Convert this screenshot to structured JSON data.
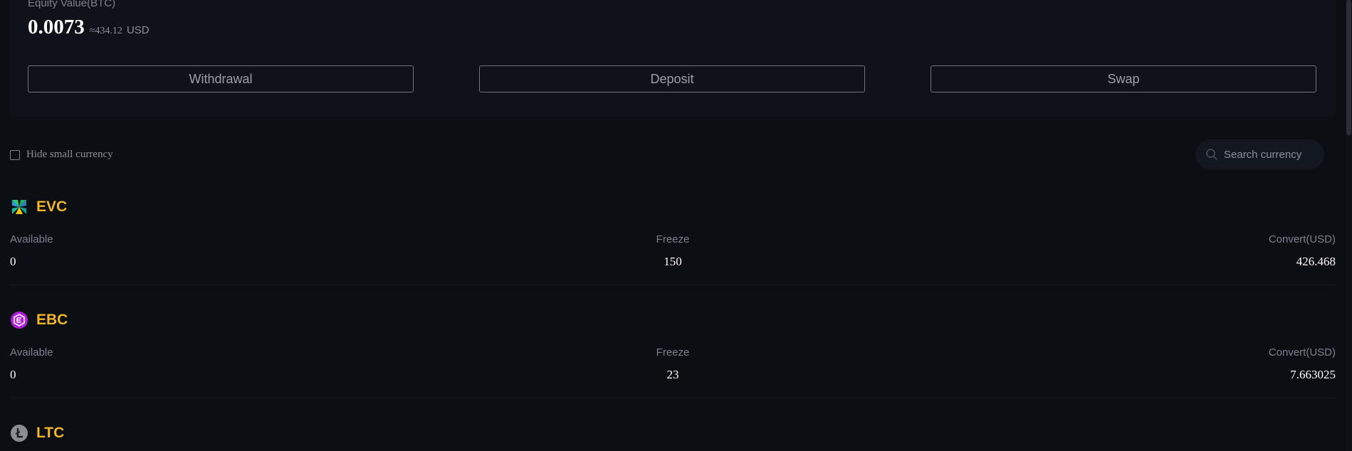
{
  "equity": {
    "label": "Equity Value(BTC)",
    "value": "0.0073",
    "approx": "≈434.12",
    "unit": "USD"
  },
  "actions": {
    "withdrawal": "Withdrawal",
    "deposit": "Deposit",
    "swap": "Swap"
  },
  "filters": {
    "hide_small_label": "Hide small currency",
    "hide_small_checked": false,
    "search_placeholder": "Search currency",
    "search_value": ""
  },
  "columns": {
    "available": "Available",
    "freeze": "Freeze",
    "convert": "Convert(USD)"
  },
  "currencies": [
    {
      "name": "EVC",
      "icon": "evc-coin-icon",
      "available": "0",
      "freeze": "150",
      "convert": "426.468"
    },
    {
      "name": "EBC",
      "icon": "ebc-coin-icon",
      "available": "0",
      "freeze": "23",
      "convert": "7.663025"
    },
    {
      "name": "LTC",
      "icon": "ltc-coin-icon"
    }
  ],
  "colors": {
    "background": "#0b0e13",
    "card": "#0f1319",
    "accent": "#f0b429",
    "muted": "#7c838e",
    "text": "#ffffff"
  }
}
